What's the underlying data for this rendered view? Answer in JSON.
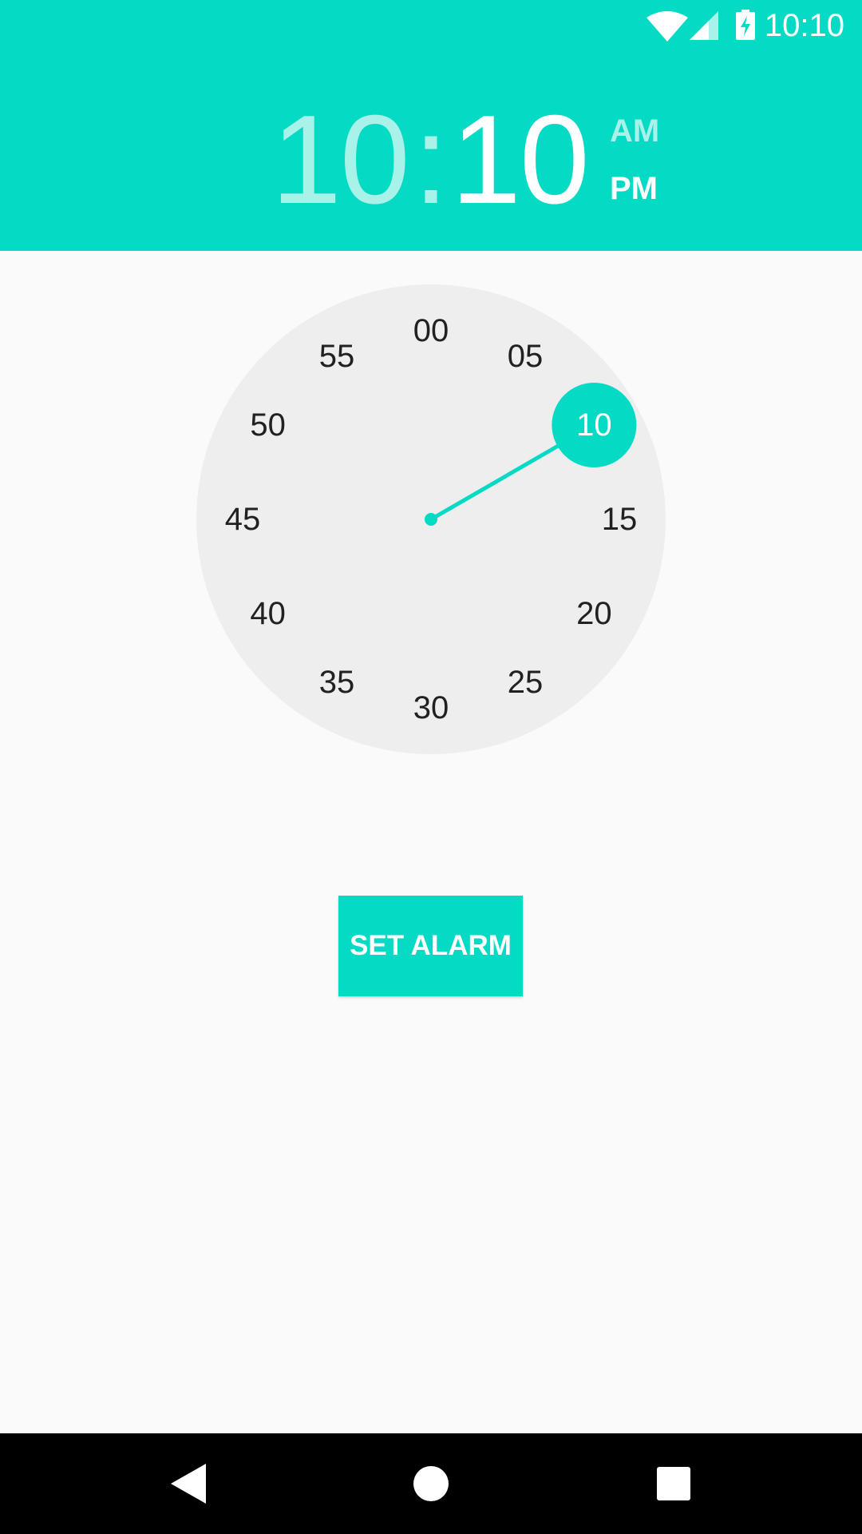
{
  "status_bar": {
    "time": "10:10",
    "icons": [
      "wifi-icon",
      "signal-icon",
      "battery-charging-icon"
    ]
  },
  "time_display": {
    "hour": "10",
    "separator": ":",
    "minute": "10",
    "am_label": "AM",
    "pm_label": "PM",
    "selected_period": "PM"
  },
  "clock": {
    "mode": "minutes",
    "selected_value": "10",
    "numbers": [
      "00",
      "05",
      "10",
      "15",
      "20",
      "25",
      "30",
      "35",
      "40",
      "45",
      "50",
      "55"
    ]
  },
  "actions": {
    "set_alarm_label": "SET ALARM"
  },
  "navigation": {
    "icons": [
      "back-icon",
      "home-icon",
      "recents-icon"
    ]
  },
  "colors": {
    "accent": "#04dac4",
    "accent_light": "#a9f2ea",
    "clock_face": "#eeeeee",
    "background": "#fafafa",
    "navbar": "#000000"
  }
}
